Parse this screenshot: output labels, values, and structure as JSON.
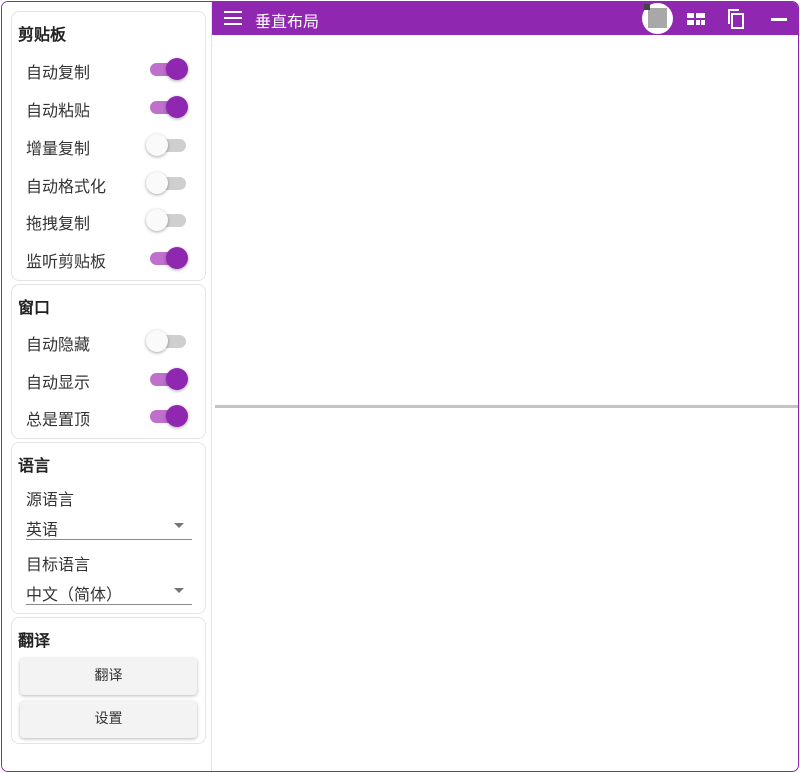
{
  "topbar": {
    "title": "垂直布局",
    "icons": [
      "menu-icon",
      "avatar",
      "layout-icon",
      "copy-icon",
      "minimize-icon"
    ]
  },
  "clipboard": {
    "title": "剪贴板",
    "items": [
      {
        "label": "自动复制",
        "on": true
      },
      {
        "label": "自动粘贴",
        "on": true
      },
      {
        "label": "增量复制",
        "on": false
      },
      {
        "label": "自动格式化",
        "on": false
      },
      {
        "label": "拖拽复制",
        "on": false
      },
      {
        "label": "监听剪贴板",
        "on": true
      }
    ]
  },
  "window": {
    "title": "窗口",
    "items": [
      {
        "label": "自动隐藏",
        "on": false
      },
      {
        "label": "自动显示",
        "on": true
      },
      {
        "label": "总是置顶",
        "on": true
      }
    ]
  },
  "language": {
    "title": "语言",
    "source_label": "源语言",
    "source_value": "英语",
    "target_label": "目标语言",
    "target_value": "中文（简体）"
  },
  "translate": {
    "title": "翻译",
    "translate_button": "翻译",
    "settings_button": "设置"
  },
  "colors": {
    "accent": "#9027b0",
    "track_on": "#bf70cc",
    "track_off": "#cfcfcf"
  }
}
